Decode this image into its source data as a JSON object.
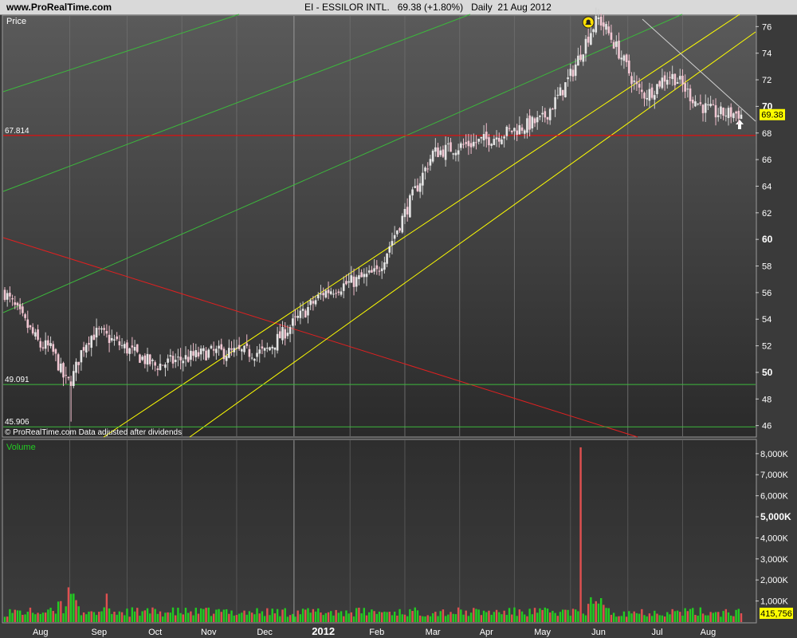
{
  "header": {
    "site": "www.ProRealTime.com",
    "title": "EI - ESSILOR INTL.   69.38 (+1.80%)   Daily  21 Aug 2012"
  },
  "price_panel": {
    "label": "Price",
    "footer": "© ProRealTime.com  Data adjusted after dividends",
    "last_price_badge": "69.38"
  },
  "volume_panel": {
    "label": "Volume",
    "last_volume_badge": "415,756"
  },
  "colors": {
    "background": "#3a3a3a",
    "up_candle": "#e6e6e6",
    "down_candle": "#f2c7d3",
    "support_line": "#ff0000",
    "green_line": "#3cb83c",
    "yellow_line": "#ffff00",
    "volume_up": "#22cc22",
    "volume_down": "#e05050",
    "badge": "#ffff00"
  },
  "chart_data": [
    {
      "type": "candlestick",
      "title": "EI - ESSILOR INTL. Daily",
      "ylabel": "Price",
      "x_labels": [
        "Aug",
        "Sep",
        "Oct",
        "Nov",
        "Dec",
        "2012",
        "Feb",
        "Mar",
        "Apr",
        "May",
        "Jun",
        "Jul",
        "Aug"
      ],
      "y_ticks": [
        46,
        48,
        50,
        52,
        54,
        56,
        58,
        60,
        62,
        64,
        66,
        68,
        70,
        72,
        74,
        76
      ],
      "ylim": [
        45.2,
        76.8
      ],
      "last_close": 69.38,
      "change_pct": 1.8,
      "horizontal_levels": [
        {
          "label": "67.814",
          "value": 67.814
        },
        {
          "label": "49.091",
          "value": 49.091
        },
        {
          "label": "45.906",
          "value": 45.906
        }
      ],
      "monthly_closes": [
        {
          "month": "Jul 2011",
          "close": 56.0
        },
        {
          "month": "Aug 2011",
          "close": 52.0
        },
        {
          "month": "Sep 2011",
          "close": 53.0
        },
        {
          "month": "Oct 2011",
          "close": 50.5
        },
        {
          "month": "Nov 2011",
          "close": 51.5
        },
        {
          "month": "Dec 2011",
          "close": 51.5
        },
        {
          "month": "Jan 2012",
          "close": 56.0
        },
        {
          "month": "Feb 2012",
          "close": 57.5
        },
        {
          "month": "Mar 2012",
          "close": 66.5
        },
        {
          "month": "Apr 2012",
          "close": 67.5
        },
        {
          "month": "May 2012",
          "close": 69.0
        },
        {
          "month": "Jun 2012",
          "close": 75.0
        },
        {
          "month": "Jul 2012",
          "close": 71.5
        },
        {
          "month": "Aug 2012",
          "close": 69.38
        }
      ]
    },
    {
      "type": "bar",
      "title": "Volume",
      "y_ticks": [
        "1,000K",
        "2,000K",
        "3,000K",
        "4,000K",
        "5,000K",
        "6,000K",
        "7,000K",
        "8,000K"
      ],
      "ylim_thousands": [
        0,
        8600
      ],
      "last_volume": 415756,
      "spike_volume_thousands": 8300
    }
  ]
}
